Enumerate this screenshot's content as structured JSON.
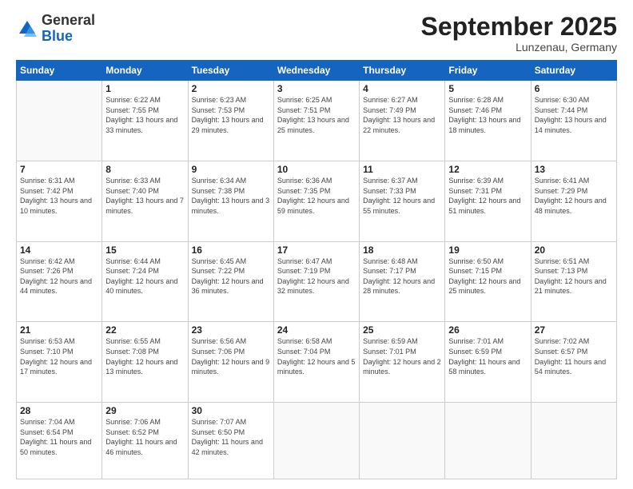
{
  "logo": {
    "general": "General",
    "blue": "Blue"
  },
  "header": {
    "month": "September 2025",
    "location": "Lunzenau, Germany"
  },
  "days_of_week": [
    "Sunday",
    "Monday",
    "Tuesday",
    "Wednesday",
    "Thursday",
    "Friday",
    "Saturday"
  ],
  "weeks": [
    [
      {
        "day": "",
        "detail": ""
      },
      {
        "day": "1",
        "detail": "Sunrise: 6:22 AM\nSunset: 7:55 PM\nDaylight: 13 hours\nand 33 minutes."
      },
      {
        "day": "2",
        "detail": "Sunrise: 6:23 AM\nSunset: 7:53 PM\nDaylight: 13 hours\nand 29 minutes."
      },
      {
        "day": "3",
        "detail": "Sunrise: 6:25 AM\nSunset: 7:51 PM\nDaylight: 13 hours\nand 25 minutes."
      },
      {
        "day": "4",
        "detail": "Sunrise: 6:27 AM\nSunset: 7:49 PM\nDaylight: 13 hours\nand 22 minutes."
      },
      {
        "day": "5",
        "detail": "Sunrise: 6:28 AM\nSunset: 7:46 PM\nDaylight: 13 hours\nand 18 minutes."
      },
      {
        "day": "6",
        "detail": "Sunrise: 6:30 AM\nSunset: 7:44 PM\nDaylight: 13 hours\nand 14 minutes."
      }
    ],
    [
      {
        "day": "7",
        "detail": "Sunrise: 6:31 AM\nSunset: 7:42 PM\nDaylight: 13 hours\nand 10 minutes."
      },
      {
        "day": "8",
        "detail": "Sunrise: 6:33 AM\nSunset: 7:40 PM\nDaylight: 13 hours\nand 7 minutes."
      },
      {
        "day": "9",
        "detail": "Sunrise: 6:34 AM\nSunset: 7:38 PM\nDaylight: 13 hours\nand 3 minutes."
      },
      {
        "day": "10",
        "detail": "Sunrise: 6:36 AM\nSunset: 7:35 PM\nDaylight: 12 hours\nand 59 minutes."
      },
      {
        "day": "11",
        "detail": "Sunrise: 6:37 AM\nSunset: 7:33 PM\nDaylight: 12 hours\nand 55 minutes."
      },
      {
        "day": "12",
        "detail": "Sunrise: 6:39 AM\nSunset: 7:31 PM\nDaylight: 12 hours\nand 51 minutes."
      },
      {
        "day": "13",
        "detail": "Sunrise: 6:41 AM\nSunset: 7:29 PM\nDaylight: 12 hours\nand 48 minutes."
      }
    ],
    [
      {
        "day": "14",
        "detail": "Sunrise: 6:42 AM\nSunset: 7:26 PM\nDaylight: 12 hours\nand 44 minutes."
      },
      {
        "day": "15",
        "detail": "Sunrise: 6:44 AM\nSunset: 7:24 PM\nDaylight: 12 hours\nand 40 minutes."
      },
      {
        "day": "16",
        "detail": "Sunrise: 6:45 AM\nSunset: 7:22 PM\nDaylight: 12 hours\nand 36 minutes."
      },
      {
        "day": "17",
        "detail": "Sunrise: 6:47 AM\nSunset: 7:19 PM\nDaylight: 12 hours\nand 32 minutes."
      },
      {
        "day": "18",
        "detail": "Sunrise: 6:48 AM\nSunset: 7:17 PM\nDaylight: 12 hours\nand 28 minutes."
      },
      {
        "day": "19",
        "detail": "Sunrise: 6:50 AM\nSunset: 7:15 PM\nDaylight: 12 hours\nand 25 minutes."
      },
      {
        "day": "20",
        "detail": "Sunrise: 6:51 AM\nSunset: 7:13 PM\nDaylight: 12 hours\nand 21 minutes."
      }
    ],
    [
      {
        "day": "21",
        "detail": "Sunrise: 6:53 AM\nSunset: 7:10 PM\nDaylight: 12 hours\nand 17 minutes."
      },
      {
        "day": "22",
        "detail": "Sunrise: 6:55 AM\nSunset: 7:08 PM\nDaylight: 12 hours\nand 13 minutes."
      },
      {
        "day": "23",
        "detail": "Sunrise: 6:56 AM\nSunset: 7:06 PM\nDaylight: 12 hours\nand 9 minutes."
      },
      {
        "day": "24",
        "detail": "Sunrise: 6:58 AM\nSunset: 7:04 PM\nDaylight: 12 hours\nand 5 minutes."
      },
      {
        "day": "25",
        "detail": "Sunrise: 6:59 AM\nSunset: 7:01 PM\nDaylight: 12 hours\nand 2 minutes."
      },
      {
        "day": "26",
        "detail": "Sunrise: 7:01 AM\nSunset: 6:59 PM\nDaylight: 11 hours\nand 58 minutes."
      },
      {
        "day": "27",
        "detail": "Sunrise: 7:02 AM\nSunset: 6:57 PM\nDaylight: 11 hours\nand 54 minutes."
      }
    ],
    [
      {
        "day": "28",
        "detail": "Sunrise: 7:04 AM\nSunset: 6:54 PM\nDaylight: 11 hours\nand 50 minutes."
      },
      {
        "day": "29",
        "detail": "Sunrise: 7:06 AM\nSunset: 6:52 PM\nDaylight: 11 hours\nand 46 minutes."
      },
      {
        "day": "30",
        "detail": "Sunrise: 7:07 AM\nSunset: 6:50 PM\nDaylight: 11 hours\nand 42 minutes."
      },
      {
        "day": "",
        "detail": ""
      },
      {
        "day": "",
        "detail": ""
      },
      {
        "day": "",
        "detail": ""
      },
      {
        "day": "",
        "detail": ""
      }
    ]
  ]
}
